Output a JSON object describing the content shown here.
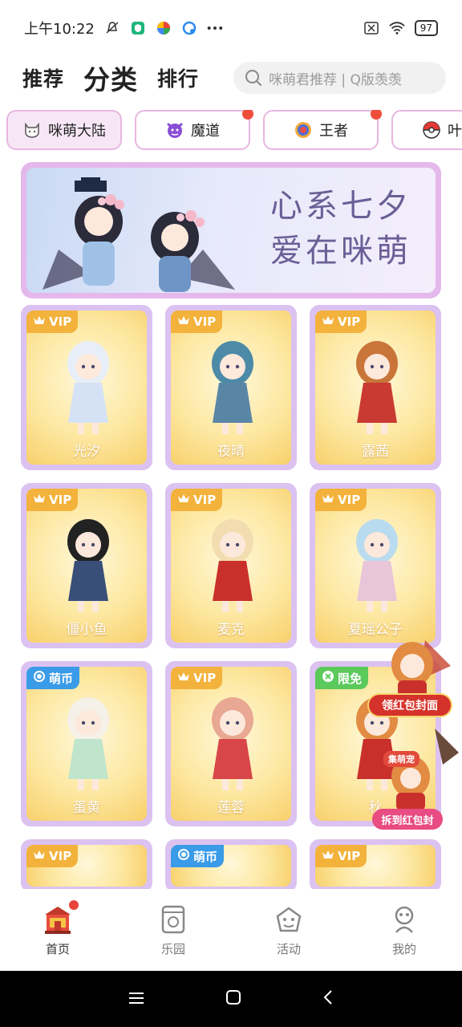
{
  "status_bar": {
    "time": "上午10:22",
    "battery": "97"
  },
  "nav": {
    "tabs": [
      "推荐",
      "分类",
      "排行"
    ],
    "active_tab": "分类",
    "search_placeholder": "咪萌君推荐 | Q版羡羡"
  },
  "categories": [
    {
      "label": "咪萌大陆",
      "icon": "cat-face-icon",
      "active": true,
      "dot": false
    },
    {
      "label": "魔道",
      "icon": "devil-face-icon",
      "active": false,
      "dot": true
    },
    {
      "label": "王者",
      "icon": "king-emblem-icon",
      "active": false,
      "dot": true
    },
    {
      "label": "叶罗",
      "icon": "pokeball-icon",
      "active": false,
      "dot": false
    }
  ],
  "banner": {
    "title_line1": "心系七夕",
    "title_line2": "爱在咪萌"
  },
  "cards": [
    {
      "name": "光汐",
      "badge": "VIP",
      "badge_type": "vip"
    },
    {
      "name": "夜晴",
      "badge": "VIP",
      "badge_type": "vip"
    },
    {
      "name": "露茜",
      "badge": "VIP",
      "badge_type": "vip"
    },
    {
      "name": "僵小鱼",
      "badge": "VIP",
      "badge_type": "vip"
    },
    {
      "name": "麦克",
      "badge": "VIP",
      "badge_type": "vip"
    },
    {
      "name": "夏瑶公子",
      "badge": "VIP",
      "badge_type": "vip"
    },
    {
      "name": "蛋黄",
      "badge": "萌币",
      "badge_type": "coin"
    },
    {
      "name": "莲蓉",
      "badge": "VIP",
      "badge_type": "vip"
    },
    {
      "name": "秋",
      "badge": "限免",
      "badge_type": "limited"
    },
    {
      "name": "",
      "badge": "VIP",
      "badge_type": "vip"
    },
    {
      "name": "",
      "badge": "萌币",
      "badge_type": "coin"
    },
    {
      "name": "",
      "badge": "VIP",
      "badge_type": "vip"
    }
  ],
  "promo": {
    "label": "领红包封面",
    "tag": "集萌宠",
    "sub_label": "拆到红包封"
  },
  "bottom_nav": [
    {
      "label": "首页",
      "icon": "temple-home-icon",
      "active": true
    },
    {
      "label": "乐园",
      "icon": "park-icon",
      "active": false
    },
    {
      "label": "活动",
      "icon": "event-icon",
      "active": false
    },
    {
      "label": "我的",
      "icon": "profile-icon",
      "active": false
    }
  ],
  "colors": {
    "accent_pink": "#e7b7df",
    "vip_gold": "#f3b23c",
    "coin_blue": "#3a9be8",
    "limited_green": "#5bc95b",
    "notify_red": "#ef4d3c"
  }
}
